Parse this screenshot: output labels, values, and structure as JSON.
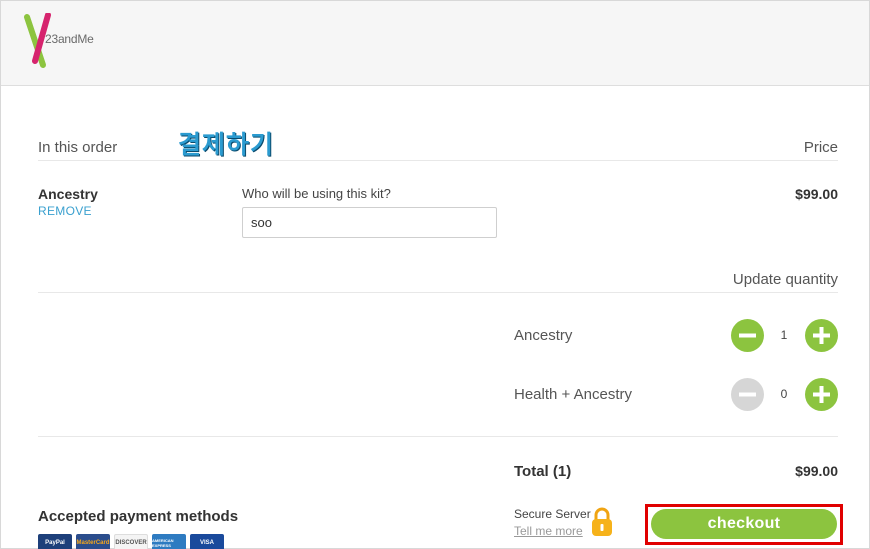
{
  "brand": {
    "logo_text": "23andMe"
  },
  "order": {
    "heading": "In this order",
    "overlay_text": "결제하기",
    "price_heading": "Price",
    "item": {
      "name": "Ancestry",
      "remove_label": "REMOVE",
      "who_label": "Who will be using this kit?",
      "who_value": "soo",
      "price": "$99.00"
    },
    "update_quantity_label": "Update quantity",
    "quantities": [
      {
        "label": "Ancestry",
        "value": "1",
        "minus_enabled": true
      },
      {
        "label": "Health + Ancestry",
        "value": "0",
        "minus_enabled": false
      }
    ],
    "total_label": "Total (1)",
    "total_value": "$99.00"
  },
  "payment": {
    "heading": "Accepted payment methods",
    "cards": [
      "PayPal",
      "MasterCard",
      "DISCOVER",
      "AMERICAN EXPRESS",
      "VISA"
    ]
  },
  "security": {
    "label": "Secure Server",
    "link": "Tell me more"
  },
  "checkout": {
    "label": "checkout"
  },
  "colors": {
    "accent_green": "#8cc43f",
    "link_blue": "#3aa0cf",
    "highlight_red": "#e00000"
  }
}
